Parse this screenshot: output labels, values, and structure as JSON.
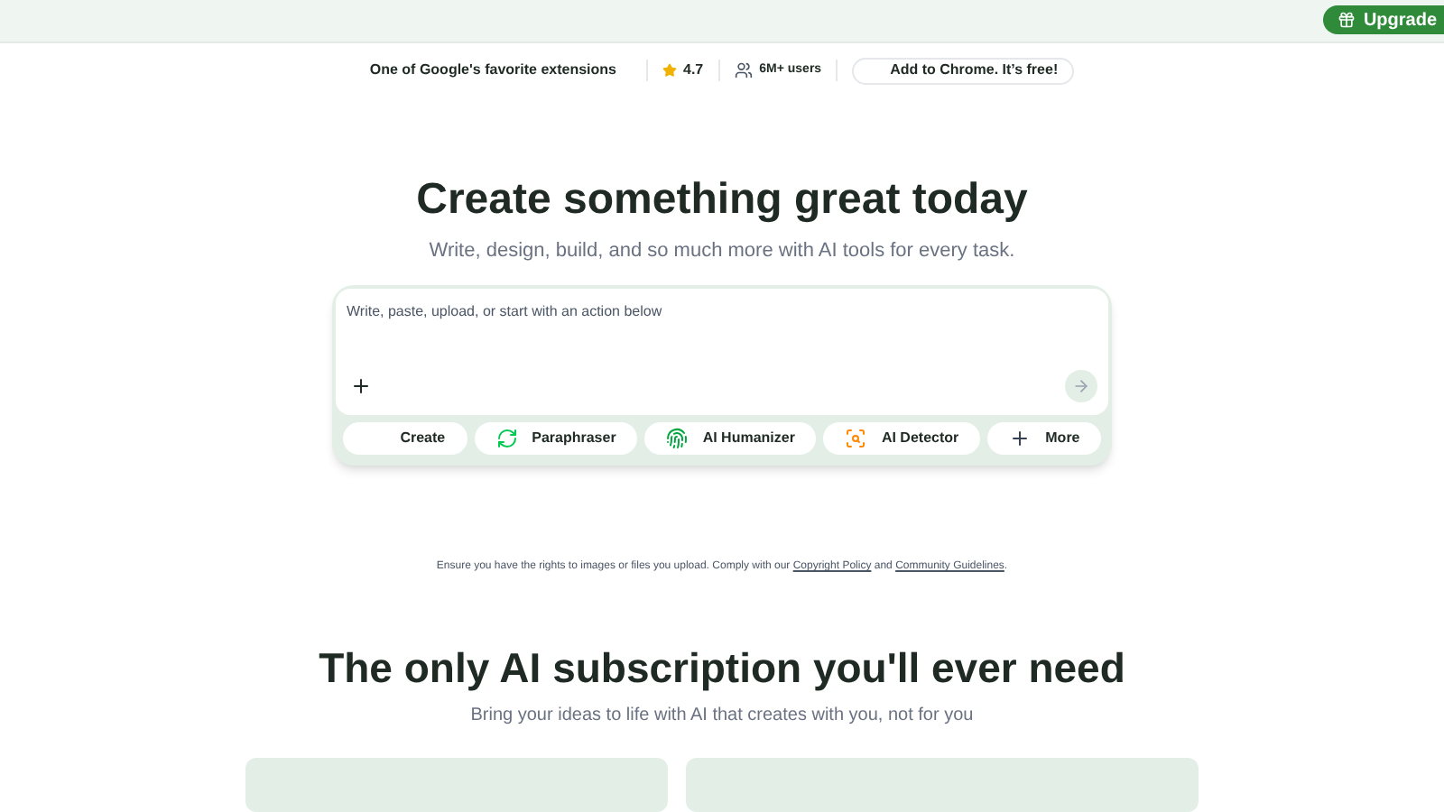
{
  "top_bar": {
    "upgrade_button": "Upgrade"
  },
  "promo_bar": {
    "tagline": "One of Google's favorite extensions",
    "rating": "4.7",
    "users": "6M+ users",
    "chrome_button": "Add to Chrome. It’s free!"
  },
  "hero": {
    "title": "Create something great today",
    "subtitle": "Write, design, build, and so much more with AI tools for every task.",
    "prompt": {
      "placeholder": "Write, paste, upload, or start with an action below"
    },
    "actions": [
      {
        "kind": "create",
        "label": "Create"
      },
      {
        "kind": "paraphraser",
        "label": "Paraphraser"
      },
      {
        "kind": "humanizer",
        "label": "AI Humanizer"
      },
      {
        "kind": "detector",
        "label": "AI Detector"
      },
      {
        "kind": "more",
        "label": "More"
      }
    ]
  },
  "notice": {
    "text": "Ensure you have the rights to images or files you upload. Comply with our",
    "link1": "Copyright Policy",
    "joiner": "and",
    "link2": "Community Guidelines",
    "end": "."
  },
  "pricing": {
    "title": "The only AI subscription you'll ever need",
    "subtitle": "Bring your ideas to life with AI that creates with you, not for you"
  }
}
